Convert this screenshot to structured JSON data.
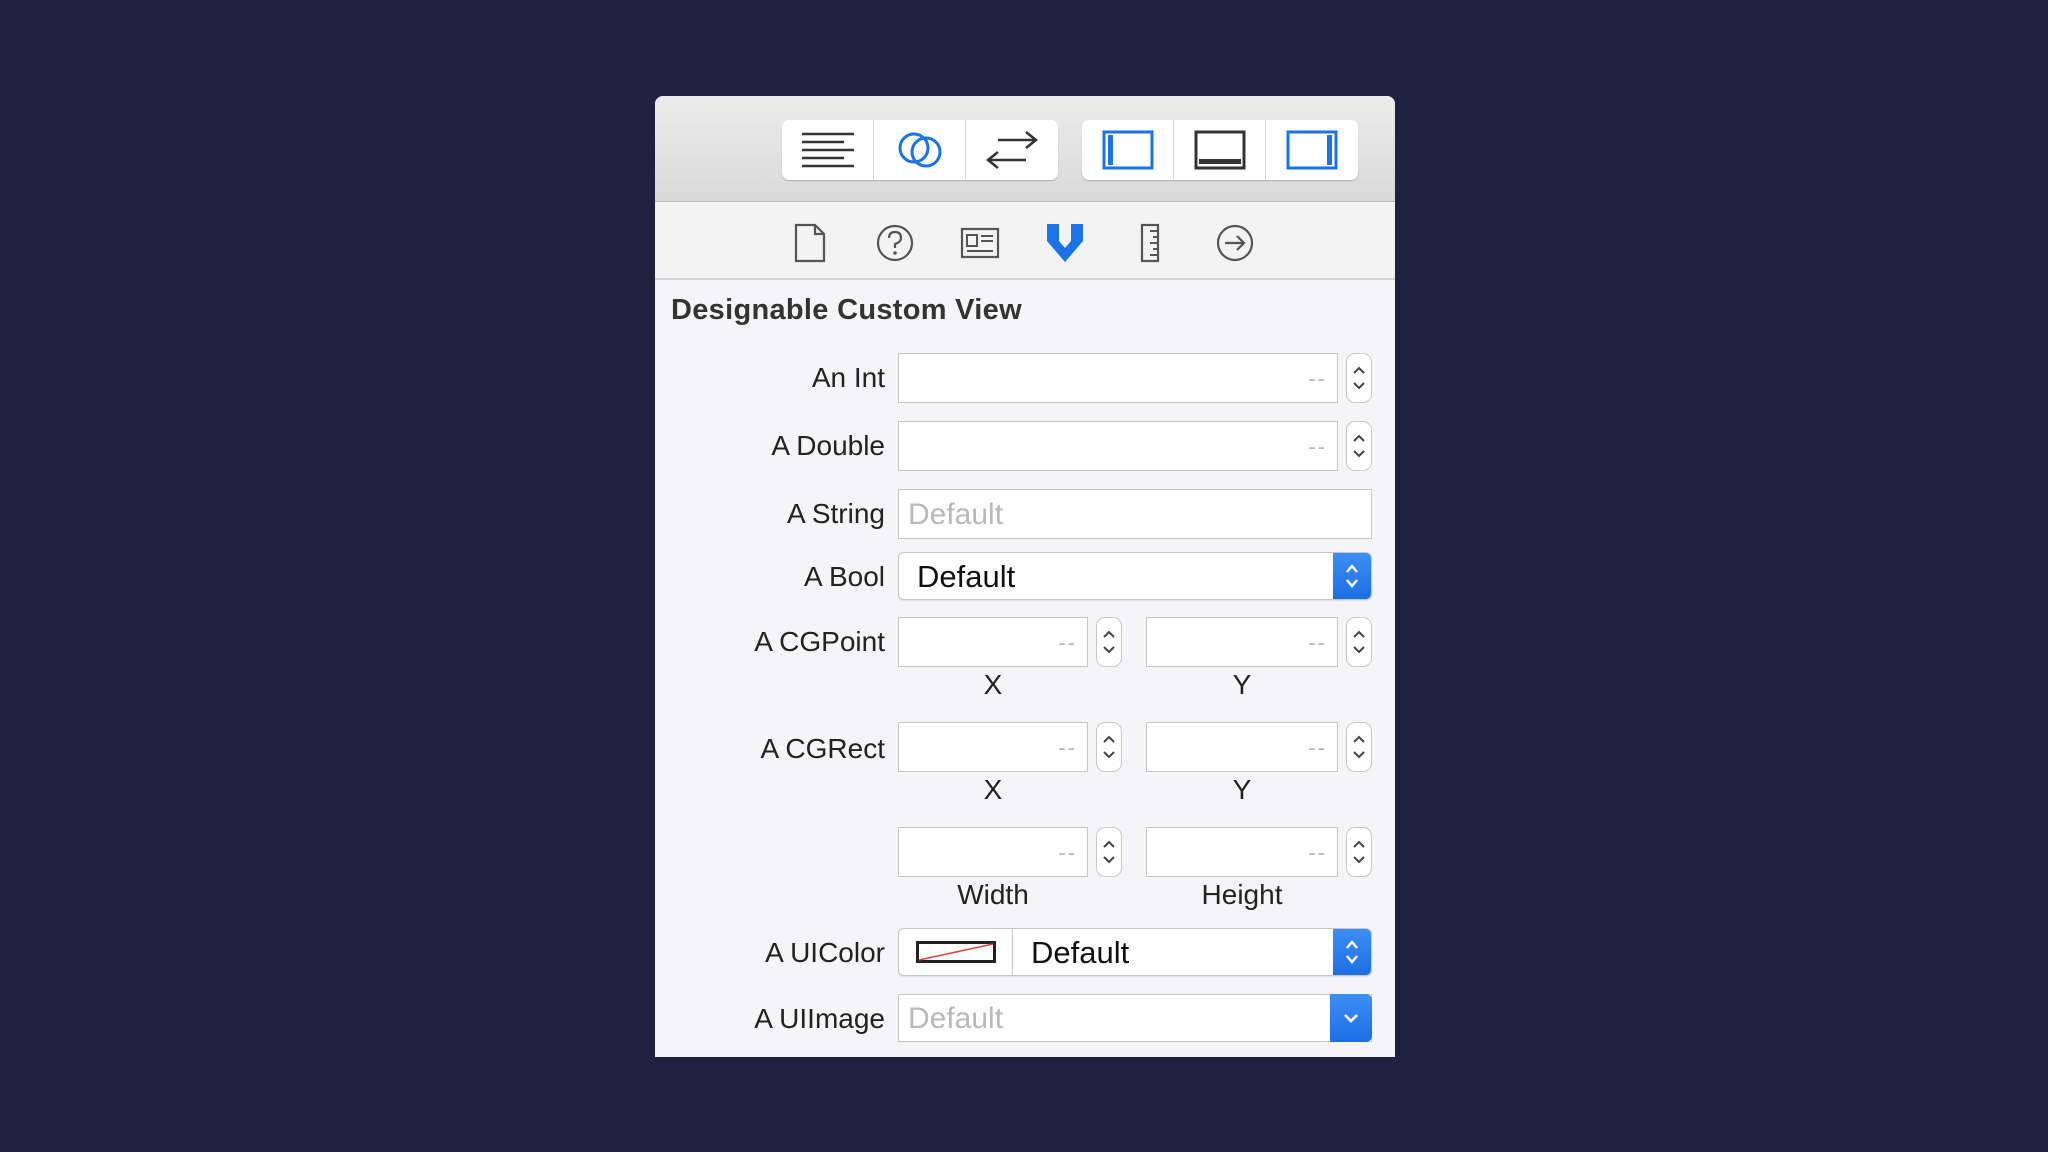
{
  "section_title": "Designable Custom View",
  "placeholder_dash": "--",
  "fields": {
    "an_int": {
      "label": "An Int"
    },
    "a_double": {
      "label": "A Double"
    },
    "a_string": {
      "label": "A String",
      "placeholder": "Default"
    },
    "a_bool": {
      "label": "A Bool",
      "value": "Default"
    },
    "a_cgpoint": {
      "label": "A CGPoint",
      "x_label": "X",
      "y_label": "Y"
    },
    "a_cgrect": {
      "label": "A CGRect",
      "x_label": "X",
      "y_label": "Y",
      "width_label": "Width",
      "height_label": "Height"
    },
    "a_uicolor": {
      "label": "A UIColor",
      "value": "Default"
    },
    "a_uiimage": {
      "label": "A UIImage",
      "placeholder": "Default"
    }
  },
  "toolbar_icons": [
    "standard-editor-icon",
    "assistant-editor-icon",
    "version-editor-icon",
    "navigator-toggle-icon",
    "debug-area-toggle-icon",
    "utilities-toggle-icon"
  ],
  "inspector_icons": [
    "file-inspector-icon",
    "quick-help-icon",
    "identity-inspector-icon",
    "attributes-inspector-icon",
    "size-inspector-icon",
    "connections-inspector-icon"
  ],
  "colors": {
    "background": "#1f2140",
    "accent": "#1a73e8",
    "panel": "#f5f5f7"
  }
}
